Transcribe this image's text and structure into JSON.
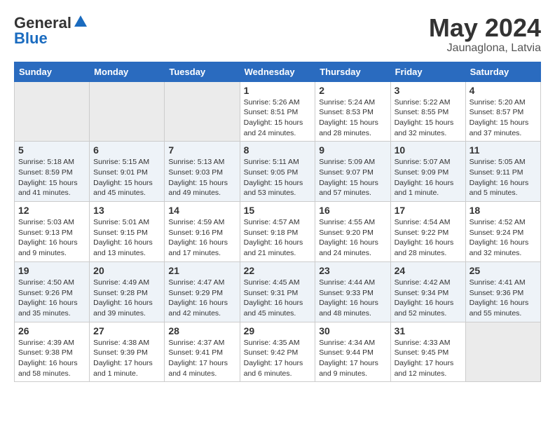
{
  "header": {
    "logo_general": "General",
    "logo_blue": "Blue",
    "month": "May 2024",
    "location": "Jaunaglona, Latvia"
  },
  "days_of_week": [
    "Sunday",
    "Monday",
    "Tuesday",
    "Wednesday",
    "Thursday",
    "Friday",
    "Saturday"
  ],
  "weeks": [
    [
      {
        "day": "",
        "info": ""
      },
      {
        "day": "",
        "info": ""
      },
      {
        "day": "",
        "info": ""
      },
      {
        "day": "1",
        "info": "Sunrise: 5:26 AM\nSunset: 8:51 PM\nDaylight: 15 hours\nand 24 minutes."
      },
      {
        "day": "2",
        "info": "Sunrise: 5:24 AM\nSunset: 8:53 PM\nDaylight: 15 hours\nand 28 minutes."
      },
      {
        "day": "3",
        "info": "Sunrise: 5:22 AM\nSunset: 8:55 PM\nDaylight: 15 hours\nand 32 minutes."
      },
      {
        "day": "4",
        "info": "Sunrise: 5:20 AM\nSunset: 8:57 PM\nDaylight: 15 hours\nand 37 minutes."
      }
    ],
    [
      {
        "day": "5",
        "info": "Sunrise: 5:18 AM\nSunset: 8:59 PM\nDaylight: 15 hours\nand 41 minutes."
      },
      {
        "day": "6",
        "info": "Sunrise: 5:15 AM\nSunset: 9:01 PM\nDaylight: 15 hours\nand 45 minutes."
      },
      {
        "day": "7",
        "info": "Sunrise: 5:13 AM\nSunset: 9:03 PM\nDaylight: 15 hours\nand 49 minutes."
      },
      {
        "day": "8",
        "info": "Sunrise: 5:11 AM\nSunset: 9:05 PM\nDaylight: 15 hours\nand 53 minutes."
      },
      {
        "day": "9",
        "info": "Sunrise: 5:09 AM\nSunset: 9:07 PM\nDaylight: 15 hours\nand 57 minutes."
      },
      {
        "day": "10",
        "info": "Sunrise: 5:07 AM\nSunset: 9:09 PM\nDaylight: 16 hours\nand 1 minute."
      },
      {
        "day": "11",
        "info": "Sunrise: 5:05 AM\nSunset: 9:11 PM\nDaylight: 16 hours\nand 5 minutes."
      }
    ],
    [
      {
        "day": "12",
        "info": "Sunrise: 5:03 AM\nSunset: 9:13 PM\nDaylight: 16 hours\nand 9 minutes."
      },
      {
        "day": "13",
        "info": "Sunrise: 5:01 AM\nSunset: 9:15 PM\nDaylight: 16 hours\nand 13 minutes."
      },
      {
        "day": "14",
        "info": "Sunrise: 4:59 AM\nSunset: 9:16 PM\nDaylight: 16 hours\nand 17 minutes."
      },
      {
        "day": "15",
        "info": "Sunrise: 4:57 AM\nSunset: 9:18 PM\nDaylight: 16 hours\nand 21 minutes."
      },
      {
        "day": "16",
        "info": "Sunrise: 4:55 AM\nSunset: 9:20 PM\nDaylight: 16 hours\nand 24 minutes."
      },
      {
        "day": "17",
        "info": "Sunrise: 4:54 AM\nSunset: 9:22 PM\nDaylight: 16 hours\nand 28 minutes."
      },
      {
        "day": "18",
        "info": "Sunrise: 4:52 AM\nSunset: 9:24 PM\nDaylight: 16 hours\nand 32 minutes."
      }
    ],
    [
      {
        "day": "19",
        "info": "Sunrise: 4:50 AM\nSunset: 9:26 PM\nDaylight: 16 hours\nand 35 minutes."
      },
      {
        "day": "20",
        "info": "Sunrise: 4:49 AM\nSunset: 9:28 PM\nDaylight: 16 hours\nand 39 minutes."
      },
      {
        "day": "21",
        "info": "Sunrise: 4:47 AM\nSunset: 9:29 PM\nDaylight: 16 hours\nand 42 minutes."
      },
      {
        "day": "22",
        "info": "Sunrise: 4:45 AM\nSunset: 9:31 PM\nDaylight: 16 hours\nand 45 minutes."
      },
      {
        "day": "23",
        "info": "Sunrise: 4:44 AM\nSunset: 9:33 PM\nDaylight: 16 hours\nand 48 minutes."
      },
      {
        "day": "24",
        "info": "Sunrise: 4:42 AM\nSunset: 9:34 PM\nDaylight: 16 hours\nand 52 minutes."
      },
      {
        "day": "25",
        "info": "Sunrise: 4:41 AM\nSunset: 9:36 PM\nDaylight: 16 hours\nand 55 minutes."
      }
    ],
    [
      {
        "day": "26",
        "info": "Sunrise: 4:39 AM\nSunset: 9:38 PM\nDaylight: 16 hours\nand 58 minutes."
      },
      {
        "day": "27",
        "info": "Sunrise: 4:38 AM\nSunset: 9:39 PM\nDaylight: 17 hours\nand 1 minute."
      },
      {
        "day": "28",
        "info": "Sunrise: 4:37 AM\nSunset: 9:41 PM\nDaylight: 17 hours\nand 4 minutes."
      },
      {
        "day": "29",
        "info": "Sunrise: 4:35 AM\nSunset: 9:42 PM\nDaylight: 17 hours\nand 6 minutes."
      },
      {
        "day": "30",
        "info": "Sunrise: 4:34 AM\nSunset: 9:44 PM\nDaylight: 17 hours\nand 9 minutes."
      },
      {
        "day": "31",
        "info": "Sunrise: 4:33 AM\nSunset: 9:45 PM\nDaylight: 17 hours\nand 12 minutes."
      },
      {
        "day": "",
        "info": ""
      }
    ]
  ]
}
